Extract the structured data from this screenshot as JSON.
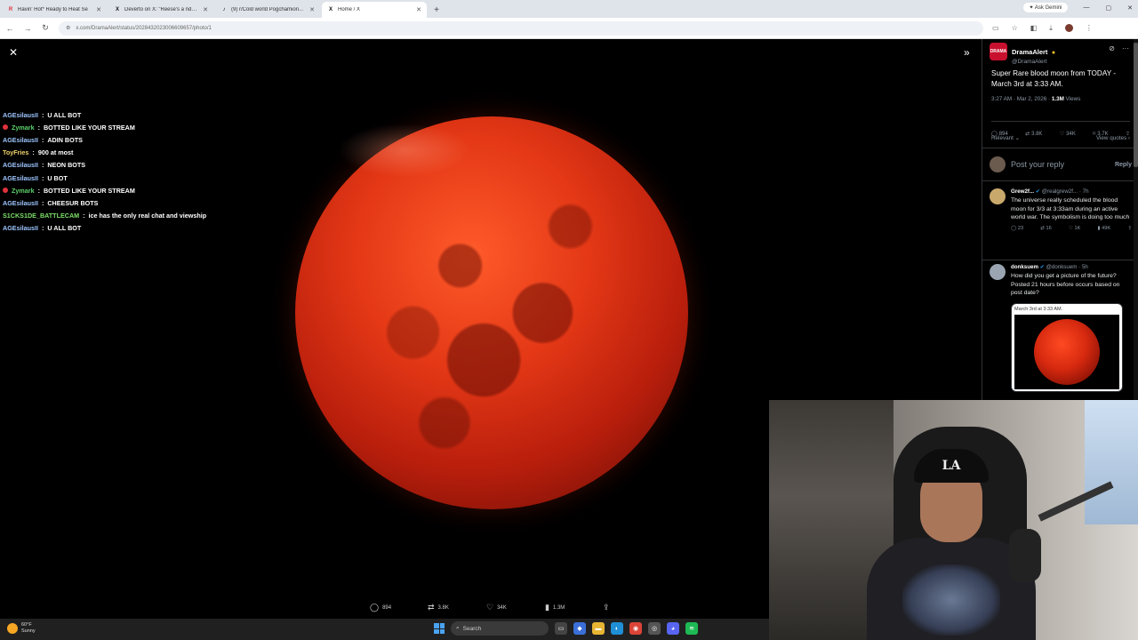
{
  "tabs": [
    {
      "label": "Ravin' Hot* Ready to Heat Se",
      "favicon": "R",
      "color": "#e0323c"
    },
    {
      "label": "Deverto on X: \"Reese's a ndcou",
      "favicon": "X",
      "color": "#111111"
    },
    {
      "label": "(9) r/Cold world Pogchamion...",
      "favicon": "♪",
      "color": "#111111"
    },
    {
      "label": "Home / X",
      "favicon": "X",
      "color": "#111111"
    }
  ],
  "browser": {
    "ask_gemini": "Ask Gemini",
    "url": "x.com/DramaAlert/status/2028432023006609657/photo/1"
  },
  "chat": [
    {
      "user": "AGEsilausII",
      "text": "U ALL BOT",
      "color": "#9ec6ff",
      "badge": false
    },
    {
      "user": "Zymark",
      "text": "BOTTED LIKE YOUR STREAM",
      "color": "#5dd36b",
      "badge": true
    },
    {
      "user": "AGEsilausII",
      "text": "ADIN BOTS",
      "color": "#9ec6ff",
      "badge": false
    },
    {
      "user": "ToyFries",
      "text": "900 at most",
      "color": "#f1d36a",
      "badge": false
    },
    {
      "user": "AGEsilausII",
      "text": "NEON BOTS",
      "color": "#9ec6ff",
      "badge": false
    },
    {
      "user": "AGEsilausII",
      "text": "U BOT",
      "color": "#9ec6ff",
      "badge": false
    },
    {
      "user": "Zymark",
      "text": "BOTTED LIKE YOUR STREAM",
      "color": "#5dd36b",
      "badge": true
    },
    {
      "user": "AGEsilausII",
      "text": "CHEESUR BOTS",
      "color": "#9ec6ff",
      "badge": false
    },
    {
      "user": "S1CKS1DE_BATTLECAM",
      "text": "ice has the only real chat and viewship",
      "color": "#7ee06b",
      "badge": false
    },
    {
      "user": "AGEsilausII",
      "text": "U ALL BOT",
      "color": "#9ec6ff",
      "badge": false
    }
  ],
  "viewer_stats": {
    "replies": "894",
    "reposts": "3.8K",
    "likes": "34K",
    "views": "1.3M"
  },
  "post": {
    "name": "DramaAlert",
    "handle": "@DramaAlert",
    "avatar_text": "DRAMA",
    "text": "Super Rare blood moon from TODAY - March 3rd at 3:33 AM.",
    "time": "3:27 AM · Mar 2, 2026 · ",
    "views_count": "1.3M",
    "views_label": " Views",
    "replies": "894",
    "reposts": "3.8K",
    "likes": "34K",
    "bookmarks": "3.7K",
    "sort_label": "Relevant",
    "view_quotes": "View quotes",
    "reply_placeholder": "Post your reply",
    "reply_button": "Reply"
  },
  "replies": [
    {
      "name": "Grew2f...",
      "handle": "@realgrew2f...",
      "age": "7h",
      "text": "The universe really scheduled the blood moon for 3/3 at 3:33am during an active world war. The symbolism is doing too much",
      "replies": "23",
      "reposts": "16",
      "likes": "1K",
      "views": "49K",
      "avatar_color": "#c9a86b"
    },
    {
      "name": "donksuem",
      "handle": "@donksuem",
      "age": "5h",
      "text": "How did you get a picture of the future? Posted 21 hours before occurs based on post date?",
      "card_caption": "March 3rd at 3:33 AM.",
      "avatar_color": "#9aa5b1"
    }
  ],
  "taskbar": {
    "temp": "60°F",
    "weather": "Sunny",
    "search": "Search"
  },
  "webcam": {
    "cap_logo": "LA"
  }
}
